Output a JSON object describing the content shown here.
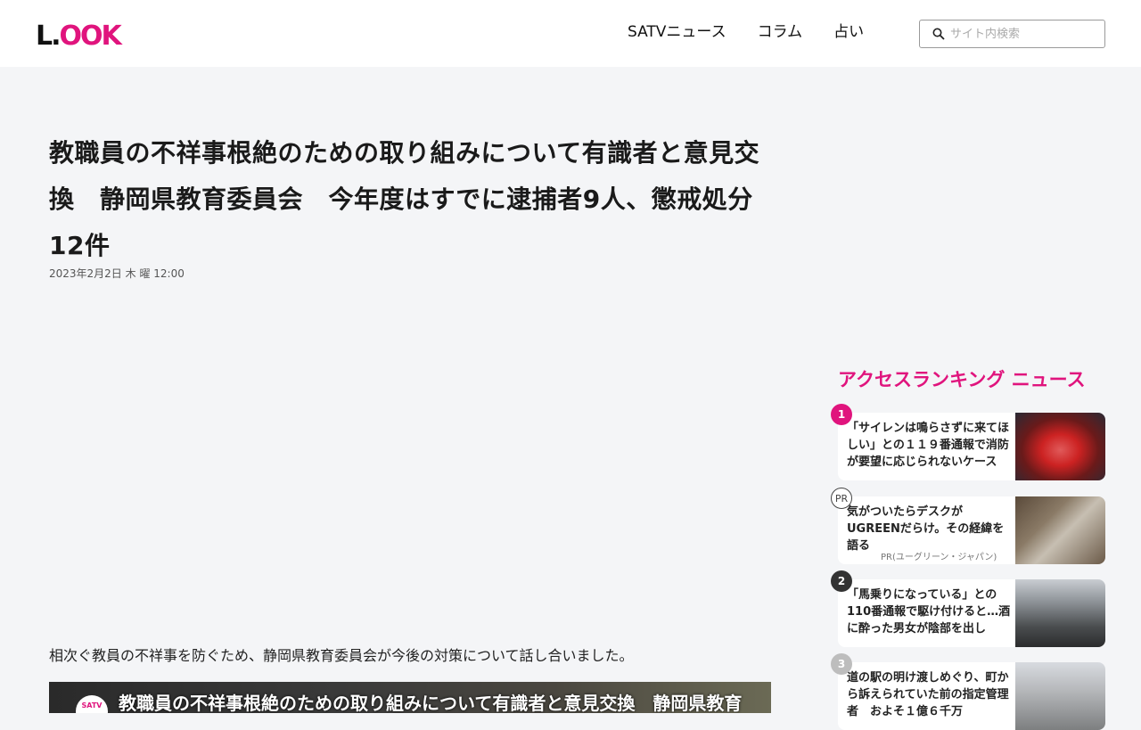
{
  "header": {
    "logo": "LOOK",
    "nav": [
      {
        "label": "SATVニュース"
      },
      {
        "label": "コラム"
      },
      {
        "label": "占い"
      }
    ],
    "search_placeholder": "サイト内検索"
  },
  "article": {
    "title": "教職員の不祥事根絶のための取り組みについて有識者と意見交換　静岡県教育委員会　今年度はすでに逮捕者9人、懲戒処分12件",
    "date": "2023年2月2日 木 曜 12:00",
    "lead": "相次ぐ教員の不祥事を防ぐため、静岡県教育委員会が今後の対策について話し合いました。",
    "video_logo": "SATV",
    "video_caption": "教職員の不祥事根絶のための取り組みについて有識者と意見交換　静岡県教育"
  },
  "sidebar": {
    "ranking_title": "アクセスランキング ニュース",
    "items": [
      {
        "badge": "1",
        "text": "「サイレンは鳴らさずに来てほしい」との１１９番通報で消防が要望に応じられないケース",
        "sponsor": ""
      },
      {
        "badge": "PR",
        "text": "気がついたらデスクがUGREENだらけ。その経緯を語る",
        "sponsor": "PR(ユーグリーン・ジャパン)"
      },
      {
        "badge": "2",
        "text": "「馬乗りになっている」との110番通報で駆け付けると…酒に酔った男女が陰部を出し",
        "sponsor": ""
      },
      {
        "badge": "3",
        "text": "道の駅の明け渡しめぐり、町から訴えられていた前の指定管理者　およそ１億６千万",
        "sponsor": ""
      }
    ]
  },
  "colors": {
    "accent": "#e0147d",
    "background": "#f4f5f7"
  }
}
